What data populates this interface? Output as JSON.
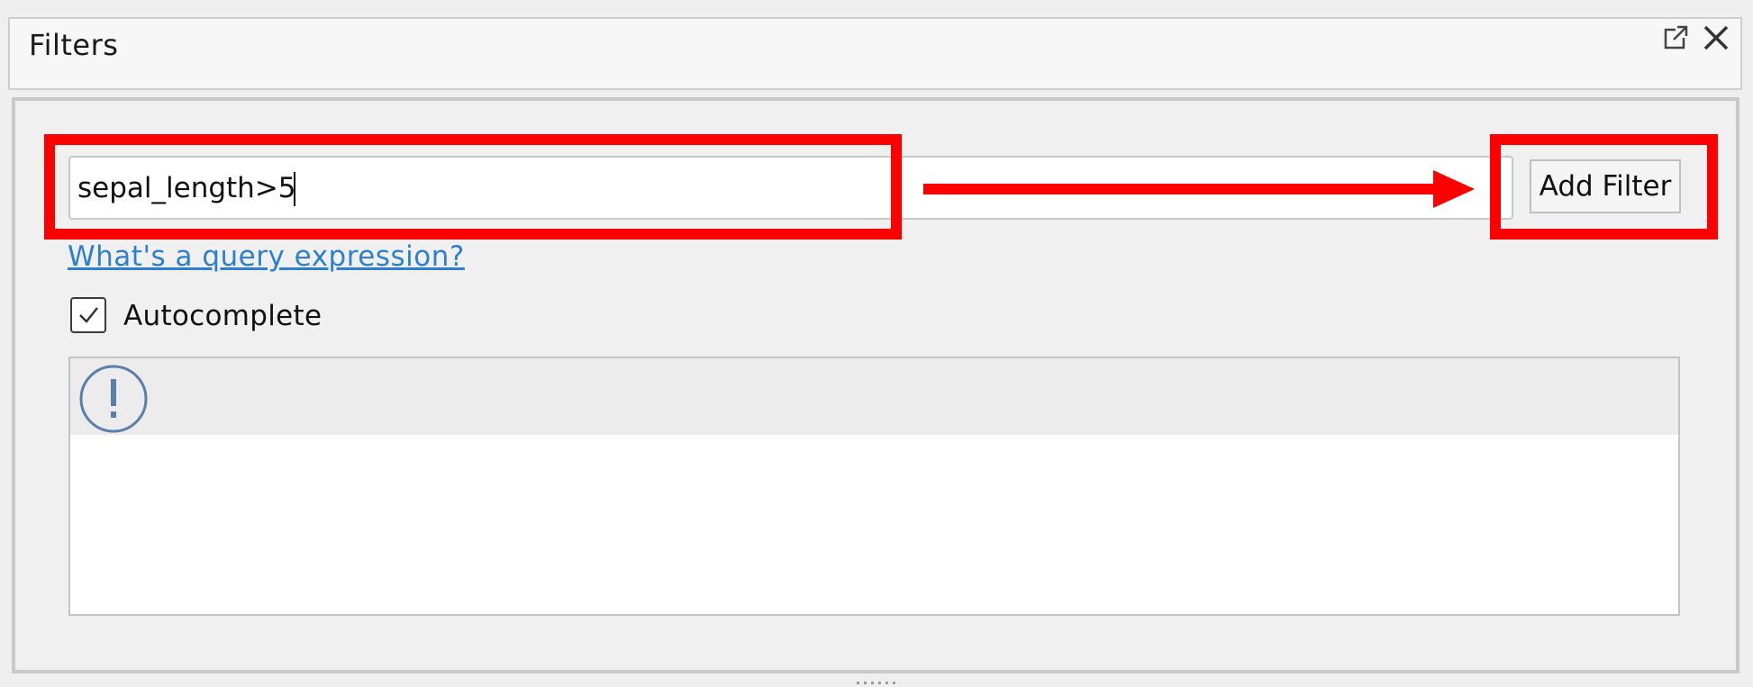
{
  "panel": {
    "title": "Filters",
    "icons": {
      "popout": "popout-icon",
      "close": "close-icon"
    }
  },
  "query": {
    "value": "sepal_length>5",
    "placeholder": ""
  },
  "toolbar": {
    "add_filter_label": "Add Filter"
  },
  "help": {
    "link_text": "What's a query expression?"
  },
  "options": {
    "autocomplete_label": "Autocomplete",
    "autocomplete_checked": true
  },
  "messages": {
    "icon": "warning-icon"
  },
  "annotation": {
    "color": "#ff0000"
  }
}
